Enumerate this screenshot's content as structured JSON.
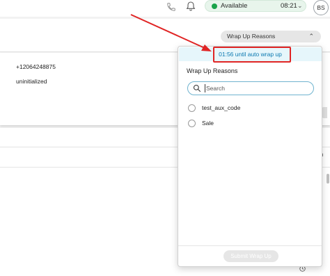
{
  "header": {
    "status_label": "Available",
    "status_time": "08:21",
    "status_color": "#19a34a",
    "avatar_initials": "BS",
    "icons": [
      "phone-icon",
      "bell-icon",
      "chevron-down-icon"
    ]
  },
  "main": {
    "wrap_up_button_label": "Wrap Up Reasons",
    "contact": {
      "phone_number": "+12064248875",
      "state": "uninitialized"
    },
    "side_text": "n"
  },
  "popover": {
    "timer_text": "01:56 until auto wrap up",
    "title": "Wrap Up Reasons",
    "search_placeholder": "Search",
    "options": [
      {
        "label": "test_aux_code",
        "selected": false
      },
      {
        "label": "Sale",
        "selected": false
      }
    ],
    "submit_label": "Submit Wrap Up",
    "submit_enabled": false
  },
  "annotation": {
    "color": "#e02424"
  }
}
